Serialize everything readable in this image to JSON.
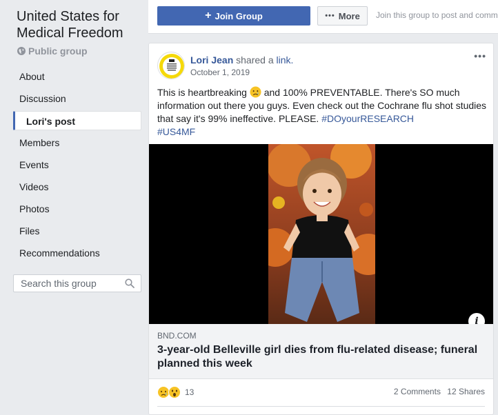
{
  "group": {
    "title": "United States for Medical Freedom",
    "privacy": "Public group"
  },
  "sidebar": {
    "items": [
      {
        "label": "About"
      },
      {
        "label": "Discussion"
      },
      {
        "label": "Lori's post"
      },
      {
        "label": "Members"
      },
      {
        "label": "Events"
      },
      {
        "label": "Videos"
      },
      {
        "label": "Photos"
      },
      {
        "label": "Files"
      },
      {
        "label": "Recommendations"
      }
    ],
    "search_placeholder": "Search this group"
  },
  "topbar": {
    "join_label": "Join Group",
    "more_label": "More",
    "join_hint": "Join this group to post and comment."
  },
  "post": {
    "author": "Lori Jean",
    "action": "shared a",
    "link_word": "link.",
    "date": "October 1, 2019",
    "text_1": "This is heartbreaking",
    "text_2": "and 100% PREVENTABLE. There's SO much information out there you guys. Even check out the Cochrane flu shot studies that say it's 99% ineffective. PLEASE.",
    "hashtag_1": "#DOyourRESEARCH",
    "hashtag_2": "#US4MF",
    "link_domain": "BND.COM",
    "link_title": "3-year-old Belleville girl dies from flu-related disease; funeral planned this week",
    "reaction_count": "13",
    "comments": "2 Comments",
    "shares": "12 Shares"
  },
  "icons": {
    "globe": "globe-icon",
    "search": "search-icon",
    "plus": "+",
    "info": "i"
  },
  "colors": {
    "brand": "#4267b2",
    "link": "#365899",
    "background": "#e9ebee"
  }
}
